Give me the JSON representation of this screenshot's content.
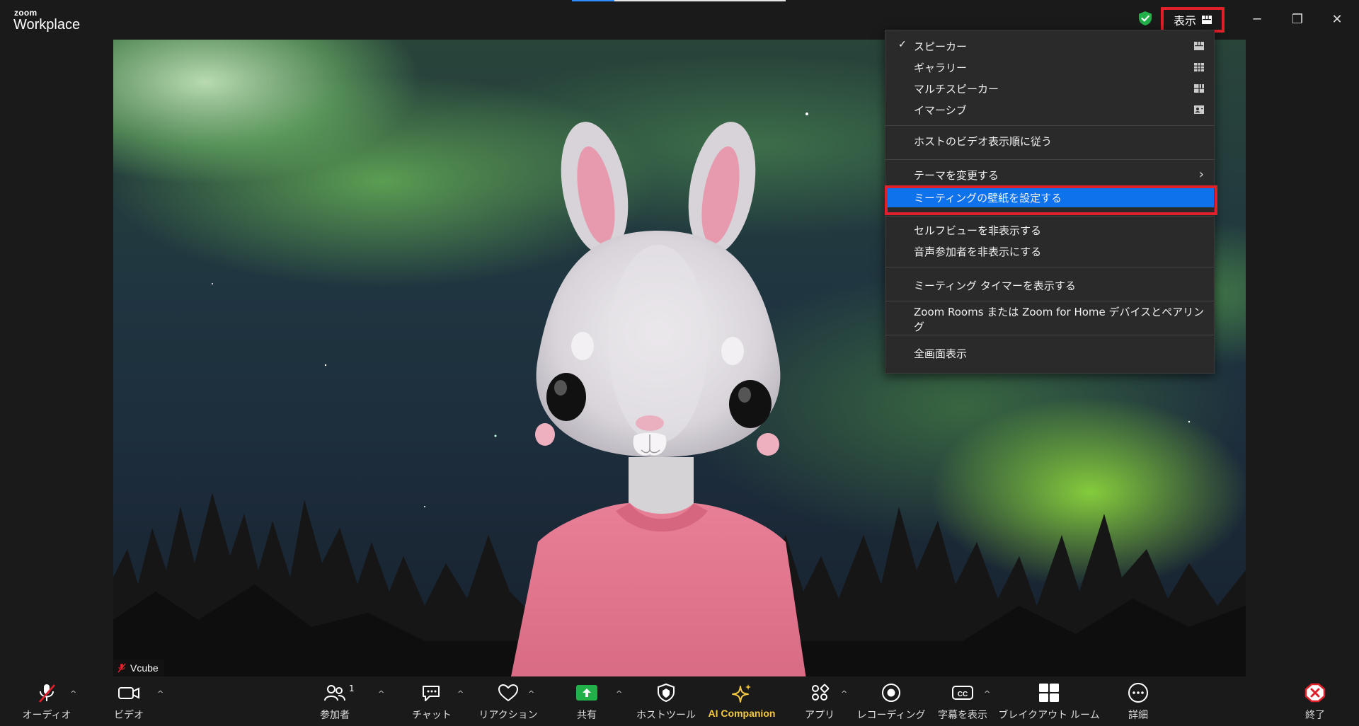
{
  "app": {
    "brand_small": "zoom",
    "brand_name": "Workplace"
  },
  "titlebar": {
    "view_button_label": "表示",
    "security_icon": "shield-check-icon",
    "security_color": "#22b04a"
  },
  "window_controls": {
    "minimize": "─",
    "restore": "❐",
    "close": "✕"
  },
  "menu": {
    "items": [
      {
        "label": "スピーカー",
        "checked": true,
        "icon": "speaker-view-icon"
      },
      {
        "label": "ギャラリー",
        "icon": "gallery-grid-icon"
      },
      {
        "label": "マルチスピーカー",
        "icon": "multi-speaker-icon"
      },
      {
        "label": "イマーシブ",
        "icon": "immersive-icon"
      },
      {
        "label": "ホストのビデオ表示順に従う"
      },
      {
        "label": "テーマを変更する",
        "has_submenu": true
      },
      {
        "label": "ミーティングの壁紙を設定する",
        "highlighted": true
      },
      {
        "label": "セルフビューを非表示する"
      },
      {
        "label": "音声参加者を非表示にする"
      },
      {
        "label": "ミーティング タイマーを表示する"
      },
      {
        "label": "Zoom Rooms または Zoom for Home デバイスとペアリング"
      },
      {
        "label": "全画面表示"
      }
    ],
    "check_mark": "✓",
    "submenu_chevron": "›",
    "highlight_color": "#0e72ed"
  },
  "video": {
    "participant_name": "Vcube",
    "muted": true
  },
  "toolbar": {
    "audio": "オーディオ",
    "video": "ビデオ",
    "participants": "参加者",
    "participants_count": "1",
    "chat": "チャット",
    "reactions": "リアクション",
    "share": "共有",
    "host_tools": "ホストツール",
    "ai_companion": "AI Companion",
    "apps": "アプリ",
    "recording": "レコーディング",
    "captions": "字幕を表示",
    "breakout": "ブレイクアウト ルーム",
    "more": "詳細",
    "end": "終了",
    "caret": "^",
    "colors": {
      "share": "#22b04a",
      "ai": "#f5c842",
      "end": "#e0202a",
      "muted": "#e0202a"
    }
  }
}
